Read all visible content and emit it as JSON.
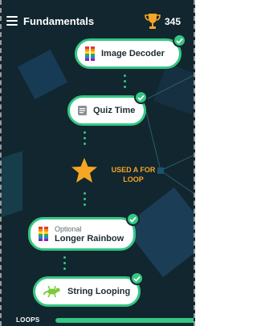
{
  "header": {
    "title": "Fundamentals",
    "score": "345",
    "menu_icon": "hamburger-menu-icon",
    "trophy_icon": "trophy-icon"
  },
  "path": {
    "nodes": [
      {
        "label": "Image Decoder",
        "icon": "rainbow-bars-icon",
        "completed": true
      },
      {
        "label": "Quiz Time",
        "icon": "quiz-card-icon",
        "completed": true
      },
      {
        "label": "Longer Rainbow",
        "sublabel": "Optional",
        "icon": "rainbow-bars-icon",
        "completed": true
      },
      {
        "label": "String Looping",
        "icon": "lizard-icon",
        "completed": true
      }
    ],
    "achievement": {
      "caption": "USED A FOR LOOP",
      "icon": "star-icon"
    }
  },
  "footer": {
    "label": "LOOPS",
    "progress": 1.0
  },
  "colors": {
    "background": "#11262f",
    "accent_green": "#34c783",
    "star_orange": "#f5a623"
  }
}
